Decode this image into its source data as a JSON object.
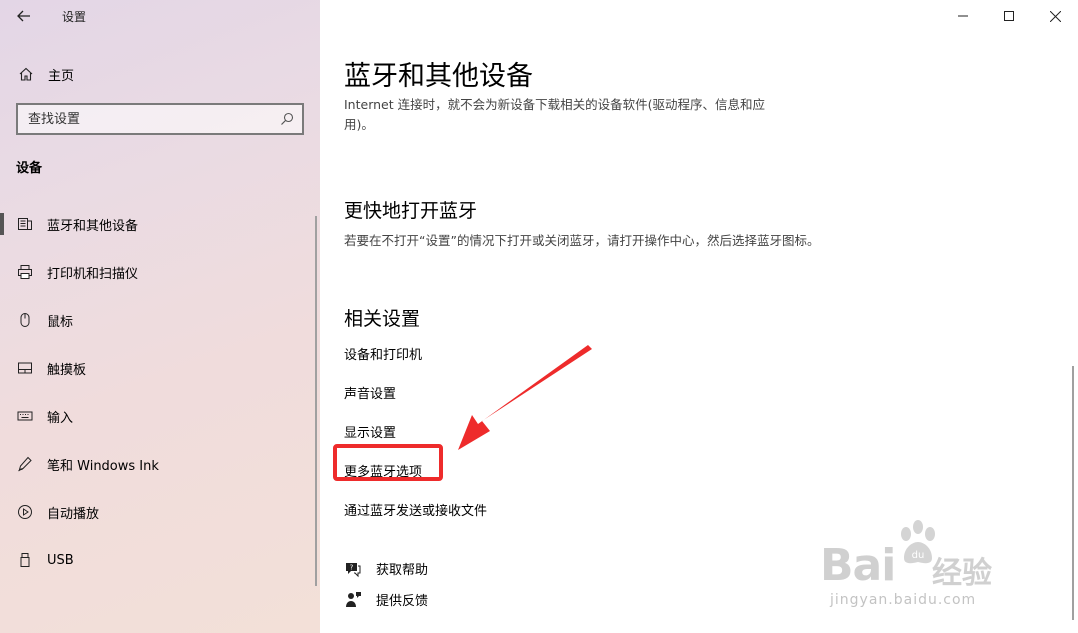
{
  "window": {
    "title": "设置"
  },
  "sidebar": {
    "home_label": "主页",
    "search_placeholder": "查找设置",
    "section_title": "设备",
    "items": [
      {
        "label": "蓝牙和其他设备",
        "icon": "bluetooth-devices-icon",
        "active": true
      },
      {
        "label": "打印机和扫描仪",
        "icon": "printer-icon"
      },
      {
        "label": "鼠标",
        "icon": "mouse-icon"
      },
      {
        "label": "触摸板",
        "icon": "touchpad-icon"
      },
      {
        "label": "输入",
        "icon": "keyboard-icon"
      },
      {
        "label": "笔和 Windows Ink",
        "icon": "pen-icon"
      },
      {
        "label": "自动播放",
        "icon": "autoplay-icon"
      },
      {
        "label": "USB",
        "icon": "usb-icon"
      }
    ]
  },
  "main": {
    "title": "蓝牙和其他设备",
    "description": "Internet 连接时，就不会为新设备下载相关的设备软件(驱动程序、信息和应用)。",
    "quick_title": "更快地打开蓝牙",
    "quick_desc": "若要在不打开“设置”的情况下打开或关闭蓝牙，请打开操作中心，然后选择蓝牙图标。",
    "related_title": "相关设置",
    "related_links": [
      "设备和打印机",
      "声音设置",
      "显示设置",
      "更多蓝牙选项",
      "通过蓝牙发送或接收文件"
    ],
    "help_label": "获取帮助",
    "feedback_label": "提供反馈"
  },
  "annotation": {
    "highlight_color": "#ee2b2b"
  },
  "watermark": {
    "brand": "Bai",
    "brand_suffix": "经验",
    "url": "jingyan.baidu.com"
  }
}
